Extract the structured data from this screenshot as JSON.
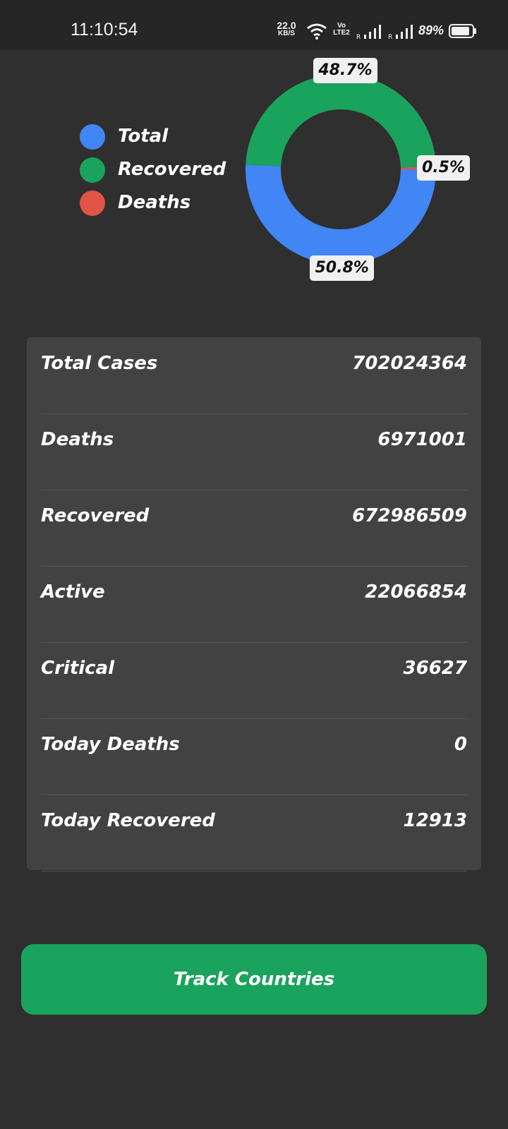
{
  "status_bar": {
    "time": "11:10:54",
    "net_speed_value": "22.0",
    "net_speed_unit": "KB/S",
    "volte_top": "Vo",
    "volte_bottom": "LTE2",
    "battery_percent": "89%",
    "battery_level": 89,
    "icons": [
      "wifi-icon",
      "volte-icon",
      "signal-icon",
      "signal-icon",
      "battery-icon"
    ]
  },
  "legend": [
    {
      "label": "Total",
      "color": "#4285f4"
    },
    {
      "label": "Recovered",
      "color": "#1aa35c"
    },
    {
      "label": "Deaths",
      "color": "#e05345"
    }
  ],
  "chart_data": {
    "type": "pie",
    "donut": true,
    "series": [
      {
        "name": "Total",
        "value": 50.8,
        "label": "50.8%",
        "color": "#4285f4"
      },
      {
        "name": "Recovered",
        "value": 48.7,
        "label": "48.7%",
        "color": "#1aa35c"
      },
      {
        "name": "Deaths",
        "value": 0.5,
        "label": "0.5%",
        "color": "#e05345"
      }
    ]
  },
  "stats": [
    {
      "label": "Total Cases",
      "value": "702024364"
    },
    {
      "label": "Deaths",
      "value": "6971001"
    },
    {
      "label": "Recovered",
      "value": "672986509"
    },
    {
      "label": "Active",
      "value": "22066854"
    },
    {
      "label": "Critical",
      "value": "36627"
    },
    {
      "label": "Today Deaths",
      "value": "0"
    },
    {
      "label": "Today Recovered",
      "value": "12913"
    }
  ],
  "track_button": {
    "label": "Track Countries"
  }
}
